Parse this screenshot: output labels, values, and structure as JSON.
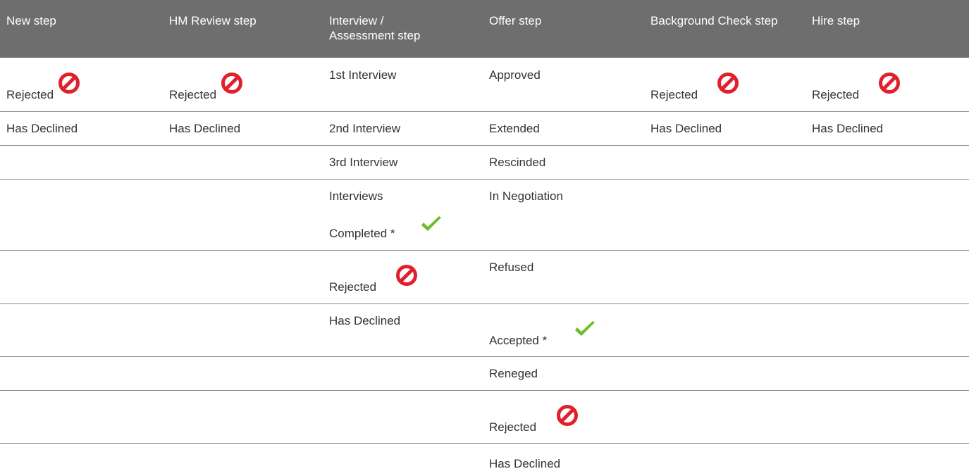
{
  "table": {
    "headers": [
      "New step",
      "HM Review step",
      "Interview / Assessment step",
      "Offer step",
      "Background Check step",
      "Hire step"
    ],
    "cells": {
      "new": {
        "rejected": "Rejected",
        "declined": "Has Declined"
      },
      "hm": {
        "rejected": "Rejected",
        "declined": "Has Declined"
      },
      "interview": {
        "first": "1st Interview",
        "second": "2nd Interview",
        "third": "3rd Interview",
        "completed_line1": "Interviews",
        "completed_line2": "Completed *",
        "rejected": "Rejected",
        "declined": "Has Declined"
      },
      "offer": {
        "approved": "Approved",
        "extended": "Extended",
        "rescinded": "Rescinded",
        "negotiation": "In Negotiation",
        "refused": "Refused",
        "accepted": "Accepted *",
        "reneged": "Reneged",
        "rejected": "Rejected",
        "declined": "Has Declined"
      },
      "background": {
        "rejected": "Rejected",
        "declined": "Has Declined"
      },
      "hire": {
        "rejected": "Rejected",
        "declined": "Has Declined"
      }
    },
    "icons": {
      "rejected": "no-entry-icon",
      "completed": "green-checkmark-icon"
    },
    "colors": {
      "header_bg": "#6e6e6e",
      "header_text": "#ffffff",
      "rejected_icon": "#e0202a",
      "check_icon": "#6cbf2a"
    }
  }
}
